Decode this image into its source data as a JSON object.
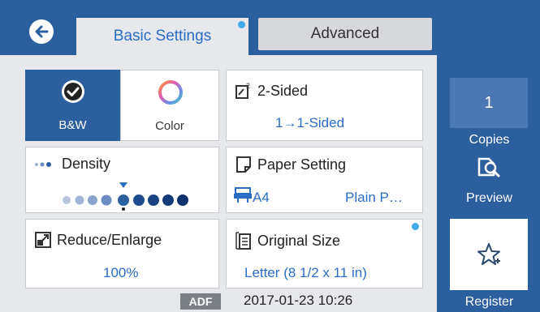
{
  "tabs": {
    "basic": "Basic Settings",
    "advanced": "Advanced"
  },
  "color_mode": {
    "bw_label": "B&W",
    "color_label": "Color",
    "selected": "B&W"
  },
  "two_sided": {
    "title": "2-Sided",
    "value": "1→1-Sided"
  },
  "density": {
    "title": "Density",
    "level": 5,
    "levels_total": 9
  },
  "paper_setting": {
    "title": "Paper Setting",
    "size": "A4",
    "type": "Plain P…"
  },
  "reduce_enlarge": {
    "title": "Reduce/Enlarge",
    "value": "100%"
  },
  "original_size": {
    "title": "Original Size",
    "value": "Letter (8 1/2 x 11 in)"
  },
  "sidebar": {
    "copies_value": "1",
    "copies_label": "Copies",
    "preview_label": "Preview",
    "register_label": "Register"
  },
  "status": {
    "source": "ADF",
    "datetime": "2017-01-23 10:26"
  },
  "colors": {
    "accent": "#2c5f9e",
    "link": "#2b6cc4",
    "indicator": "#43a9e8"
  }
}
